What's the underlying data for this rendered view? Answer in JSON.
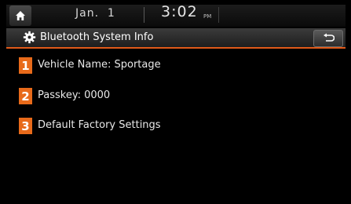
{
  "status_bar": {
    "date": "Jan.  1",
    "time": "3:02",
    "ampm": "PM"
  },
  "header": {
    "title": "Bluetooth System Info",
    "icon": "gear-icon",
    "back_icon": "back-arrow-icon"
  },
  "items": [
    {
      "number": "1",
      "label": "Vehicle Name: Sportage"
    },
    {
      "number": "2",
      "label": "Passkey: 0000"
    },
    {
      "number": "3",
      "label": "Default Factory Settings"
    }
  ],
  "colors": {
    "accent": "#e86a1a",
    "background": "#000000",
    "text": "#e8e8e8"
  }
}
